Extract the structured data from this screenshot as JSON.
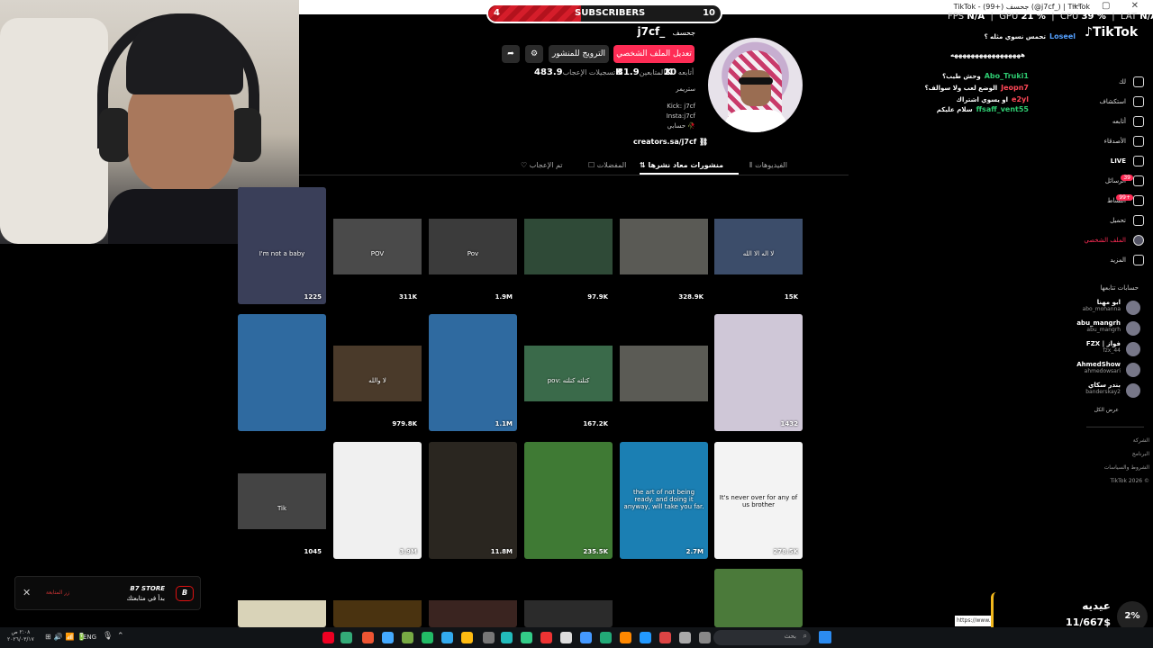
{
  "window": {
    "title": "TikTok - (99+) جحسف (@j7cf_) | TikTok",
    "controls": "— ▢ ✕"
  },
  "stream": {
    "subs": {
      "label": "SUBSCRIBERS",
      "current": "4",
      "goal": "10",
      "progress": 0.4
    },
    "perf": {
      "fps_label": "FPS",
      "fps": "N/A",
      "gpu_label": "GPU",
      "gpu": "21 %",
      "cpu_label": "CPU",
      "cpu": "39 %",
      "lat_label": "LAT",
      "lat": "N/A"
    },
    "chat": [
      {
        "user": "Loseel",
        "text": "تحمس نسوي مثله ؟",
        "color": "#54a0ff"
      },
      {
        "user": "",
        "text": "هههههههههههههههههه",
        "color": "#ffffff"
      },
      {
        "user": "Abo_Truki1",
        "text": "وحش طيب؟",
        "color": "#2ecc71"
      },
      {
        "user": "Jeopn7",
        "text": "الوضع لعب ولا سوالف؟",
        "color": "#ff4757"
      },
      {
        "user": "e2yl",
        "text": "او يسوي اشتراك",
        "color": "#ff4757"
      },
      {
        "user": "ffsaff_vent55",
        "text": "سلام عليكم",
        "color": "#2ecc71"
      }
    ],
    "notify": {
      "brand": "B7 STORE",
      "msg": "بدأ في متابعتك",
      "close": "✕",
      "side": "زر المتابعة"
    },
    "goal": {
      "title": "عيديه",
      "amount": "11/667$",
      "percent": "2%",
      "url": "https://www..."
    }
  },
  "profile": {
    "display_name": "جحسف",
    "username": "j7cf_",
    "edit_button": "تعديل الملف الشخصي",
    "promote_button": "الترويج للمنشور",
    "following_label": "أتابعه",
    "following": "20",
    "followers_label": "المتابعين",
    "followers": "31.9K",
    "likes_label": "تسجيلات الإعجاب",
    "likes": "483.9K",
    "bio": [
      "ستريمر",
      "Kick: j7cf",
      "Insta:j7cf",
      "حسابي 🥀"
    ],
    "link": "creators.sa/j7cf"
  },
  "tabs": [
    {
      "label": "الفيديوهات"
    },
    {
      "label": "منشورات معاد نشرها"
    },
    {
      "label": "المفضلات"
    },
    {
      "label": "تم الإعجاب"
    }
  ],
  "sidebar": {
    "logo": "TikTok",
    "nav": [
      "لك",
      "استكشاف",
      "أتابعه",
      "الأصدقاء",
      "LIVE",
      "الرسائل",
      "النشاط",
      "تحميل",
      "الملف الشخصي",
      "المزيد"
    ],
    "messages_badge": "39",
    "activity_badge": "99+",
    "following_title": "حسابات تتابعها",
    "accounts": [
      {
        "name": "ابو مهنا",
        "handle": "abo_mohanna"
      },
      {
        "name": "abu_mangrh",
        "handle": "abu_mangrh"
      },
      {
        "name": "FZX | فواز",
        "handle": "fzx_44"
      },
      {
        "name": "AhmedShow",
        "handle": "ahmedowsari"
      },
      {
        "name": "بندر سكاي",
        "handle": "banderskay2"
      }
    ],
    "see_all": "عرض الكل",
    "footer": [
      "الشركة",
      "البرنامج",
      "الشروط والسياسات",
      "TikTok 2026 ©"
    ]
  },
  "videos": [
    {
      "count": "1225",
      "caption": "I'm not a baby",
      "bg": "#3a3f59"
    },
    {
      "count": "311K",
      "caption": "POV",
      "bg": "#4a4a4a"
    },
    {
      "count": "1.9M",
      "caption": "Pov",
      "bg": "#3b3b3b"
    },
    {
      "count": "97.9K",
      "caption": "",
      "bg": "#2f4a37"
    },
    {
      "count": "328.9K",
      "caption": "",
      "bg": "#5a5a55"
    },
    {
      "count": "15K",
      "caption": "لا اله الا الله",
      "bg": "#3c4d6a"
    },
    {
      "count": "",
      "caption": "",
      "bg": "#2f6aa0"
    },
    {
      "count": "979.8K",
      "caption": "لا والله",
      "bg": "#4a3a2a"
    },
    {
      "count": "1.1M",
      "caption": "",
      "bg": "#2f6aa0"
    },
    {
      "count": "167.2K",
      "caption": "pov: كتلته كتلته",
      "bg": "#3a6a4a"
    },
    {
      "count": "",
      "caption": "",
      "bg": "#5b5b55"
    },
    {
      "count": "1432",
      "caption": "",
      "bg": "#cfc7d7"
    },
    {
      "count": "1045",
      "caption": "Tik",
      "bg": "#444"
    },
    {
      "count": "3.9M",
      "caption": "",
      "bg": "#f0f0f0"
    },
    {
      "count": "11.8M",
      "caption": "",
      "bg": "#2a2620"
    },
    {
      "count": "235.5K",
      "caption": "",
      "bg": "#3f7a34"
    },
    {
      "count": "2.7M",
      "caption": "the art of not being ready. and doing it anyway, will take you far.",
      "bg": "#1b7fb3"
    },
    {
      "count": "278.5K",
      "caption": "It's never over for any of us brother",
      "bg": "#f3f3f3"
    },
    {
      "count": "",
      "caption": "",
      "bg": "#d9d3b8"
    },
    {
      "count": "",
      "caption": "",
      "bg": "#4a3310"
    },
    {
      "count": "",
      "caption": "",
      "bg": "#3a2420"
    },
    {
      "count": "",
      "caption": "",
      "bg": "#2b2b2b"
    },
    {
      "count": "",
      "caption": "",
      "bg": "#000000"
    },
    {
      "count": "",
      "caption": "",
      "bg": "#4b7a3a"
    }
  ],
  "taskbar": {
    "time": "٢:٠٨ ص",
    "date": "٢٠٢٦/٠٣/١٧",
    "lang": "ENG",
    "search": "بحث"
  }
}
